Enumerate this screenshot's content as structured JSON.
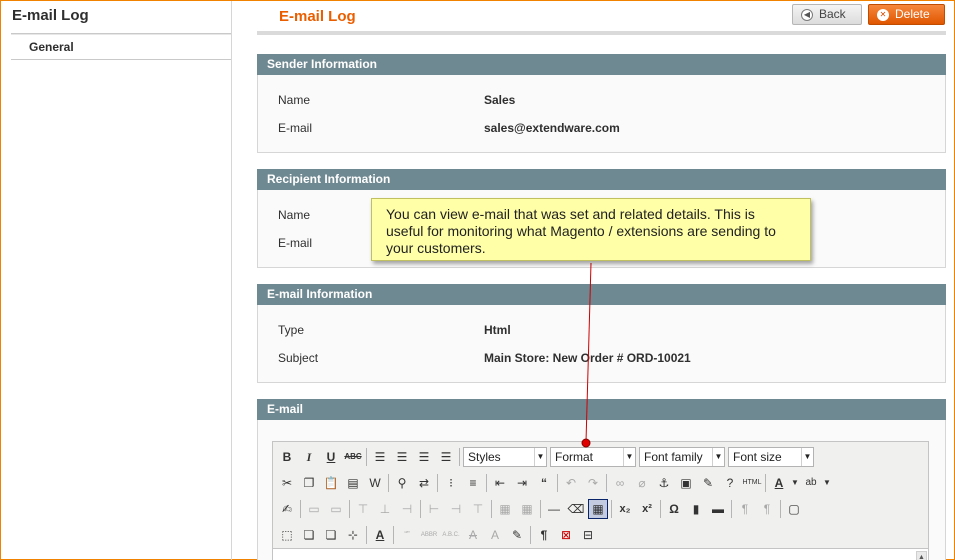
{
  "sidebar": {
    "title": "E-mail Log",
    "tabs": [
      {
        "label": "General",
        "active": true
      }
    ]
  },
  "header": {
    "title": "E-mail Log",
    "back_label": "Back",
    "delete_label": "Delete"
  },
  "sections": {
    "sender": {
      "title": "Sender Information",
      "rows": [
        {
          "label": "Name",
          "value": "Sales"
        },
        {
          "label": "E-mail",
          "value": "sales@extendware.com"
        }
      ]
    },
    "recipient": {
      "title": "Recipient Information",
      "rows": [
        {
          "label": "Name",
          "value": ""
        },
        {
          "label": "E-mail",
          "value": ""
        }
      ]
    },
    "email_info": {
      "title": "E-mail Information",
      "rows": [
        {
          "label": "Type",
          "value": "Html"
        },
        {
          "label": "Subject",
          "value": "Main Store: New Order # ORD-10021"
        }
      ]
    },
    "email": {
      "title": "E-mail"
    }
  },
  "editor": {
    "styles_label": "Styles",
    "format_label": "Format",
    "font_family_label": "Font family",
    "font_size_label": "Font size"
  },
  "tooltip": {
    "text": "You can view e-mail that was set and related details. This is useful for monitoring what Magento / extensions are sending to your customers."
  },
  "colors": {
    "accent": "#eb5e00",
    "section_header": "#6f8992",
    "tooltip_bg": "#ffffa8",
    "callout": "#cc0000"
  }
}
